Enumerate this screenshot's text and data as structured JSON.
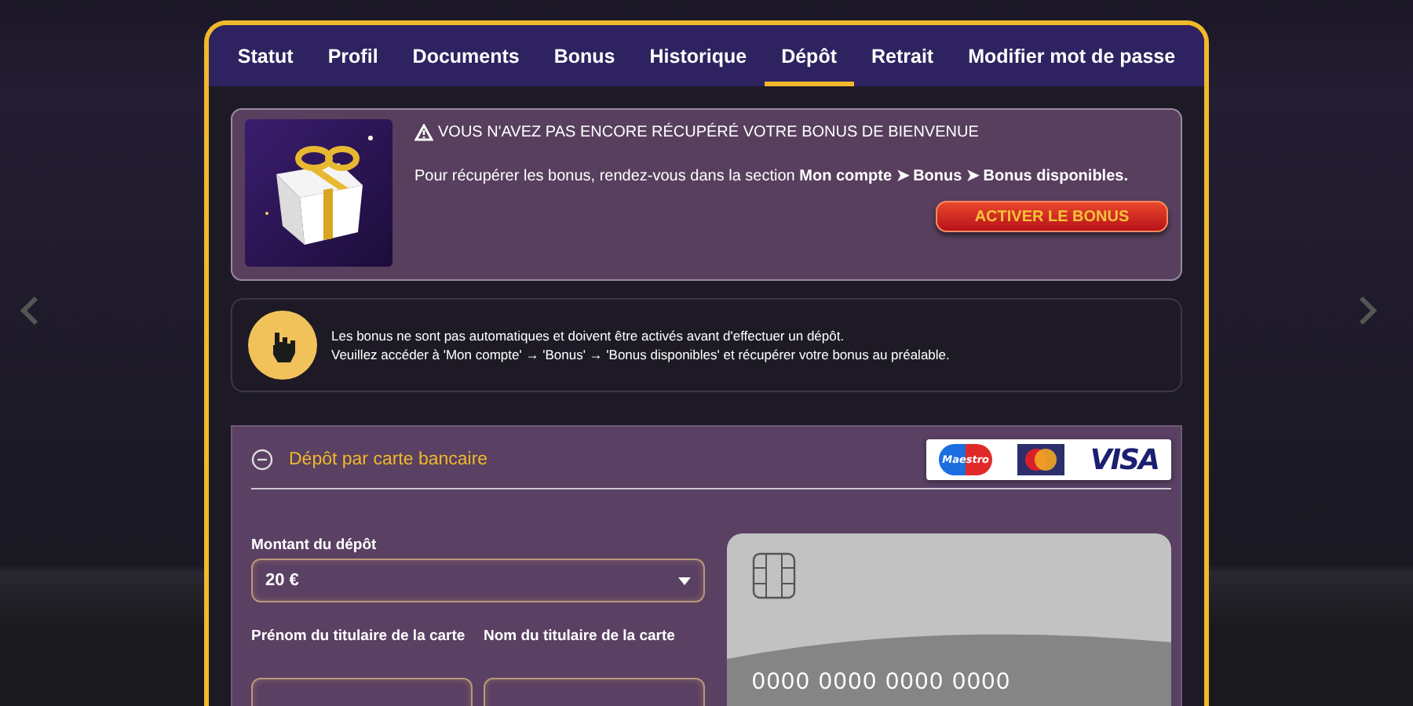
{
  "tabs": [
    {
      "label": "Statut",
      "selected": false
    },
    {
      "label": "Profil",
      "selected": false
    },
    {
      "label": "Documents",
      "selected": false
    },
    {
      "label": "Bonus",
      "selected": false
    },
    {
      "label": "Historique",
      "selected": false
    },
    {
      "label": "Dépôt",
      "selected": true
    },
    {
      "label": "Retrait",
      "selected": false
    },
    {
      "label": "Modifier mot de passe",
      "selected": false
    }
  ],
  "bonus_alert": {
    "title": "VOUS N'AVEZ PAS ENCORE RÉCUPÉRÉ VOTRE BONUS DE BIENVENUE",
    "text": "Pour récupérer les bonus, rendez-vous dans la section **Mon compte ➤ Bonus ➤ Bonus disponibles.**",
    "button": "ACTIVER LE BONUS"
  },
  "notice": {
    "lines": [
      "Les bonus ne sont pas automatiques et doivent être activés avant d'effectuer un dépôt.",
      "Veuillez accéder à 'Mon compte' → 'Bonus' → 'Bonus disponibles' et récupérer votre bonus au préalable."
    ]
  },
  "deposit": {
    "title": "Dépôt par carte bancaire",
    "expanded": true,
    "logos": [
      {
        "kind": "maestro",
        "label": "Maestro"
      },
      {
        "kind": "mastercard"
      },
      {
        "kind": "visa",
        "label": "VISA"
      }
    ],
    "amount": {
      "label": "Montant du dépôt",
      "value": "20 €"
    },
    "fields": [
      {
        "label": "Prénom du titulaire de la carte"
      },
      {
        "label": "Nom du titulaire de la carte"
      }
    ],
    "card_number": "0000 0000 0000 0000"
  }
}
